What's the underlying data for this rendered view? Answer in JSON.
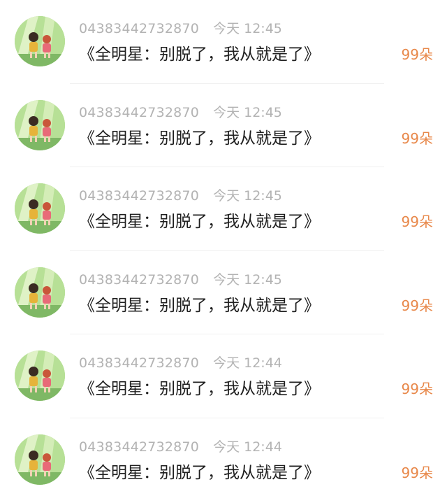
{
  "colors": {
    "meta_text": "#b3b3b3",
    "title_text": "#1f1f1f",
    "gift_text": "#e8884a",
    "avatar_bg": "#a9d98a"
  },
  "items": [
    {
      "avatar_icon": "avatar-cartoon-children-icon",
      "user_id": "04383442732870",
      "time": "今天 12:45",
      "title": "《全明星：别脱了，我从就是了》",
      "gift": "99朵"
    },
    {
      "avatar_icon": "avatar-cartoon-children-icon",
      "user_id": "04383442732870",
      "time": "今天 12:45",
      "title": "《全明星：别脱了，我从就是了》",
      "gift": "99朵"
    },
    {
      "avatar_icon": "avatar-cartoon-children-icon",
      "user_id": "04383442732870",
      "time": "今天 12:45",
      "title": "《全明星：别脱了，我从就是了》",
      "gift": "99朵"
    },
    {
      "avatar_icon": "avatar-cartoon-children-icon",
      "user_id": "04383442732870",
      "time": "今天 12:45",
      "title": "《全明星：别脱了，我从就是了》",
      "gift": "99朵"
    },
    {
      "avatar_icon": "avatar-cartoon-children-icon",
      "user_id": "04383442732870",
      "time": "今天 12:44",
      "title": "《全明星：别脱了，我从就是了》",
      "gift": "99朵"
    },
    {
      "avatar_icon": "avatar-cartoon-children-icon",
      "user_id": "04383442732870",
      "time": "今天 12:44",
      "title": "《全明星：别脱了，我从就是了》",
      "gift": "99朵"
    }
  ]
}
